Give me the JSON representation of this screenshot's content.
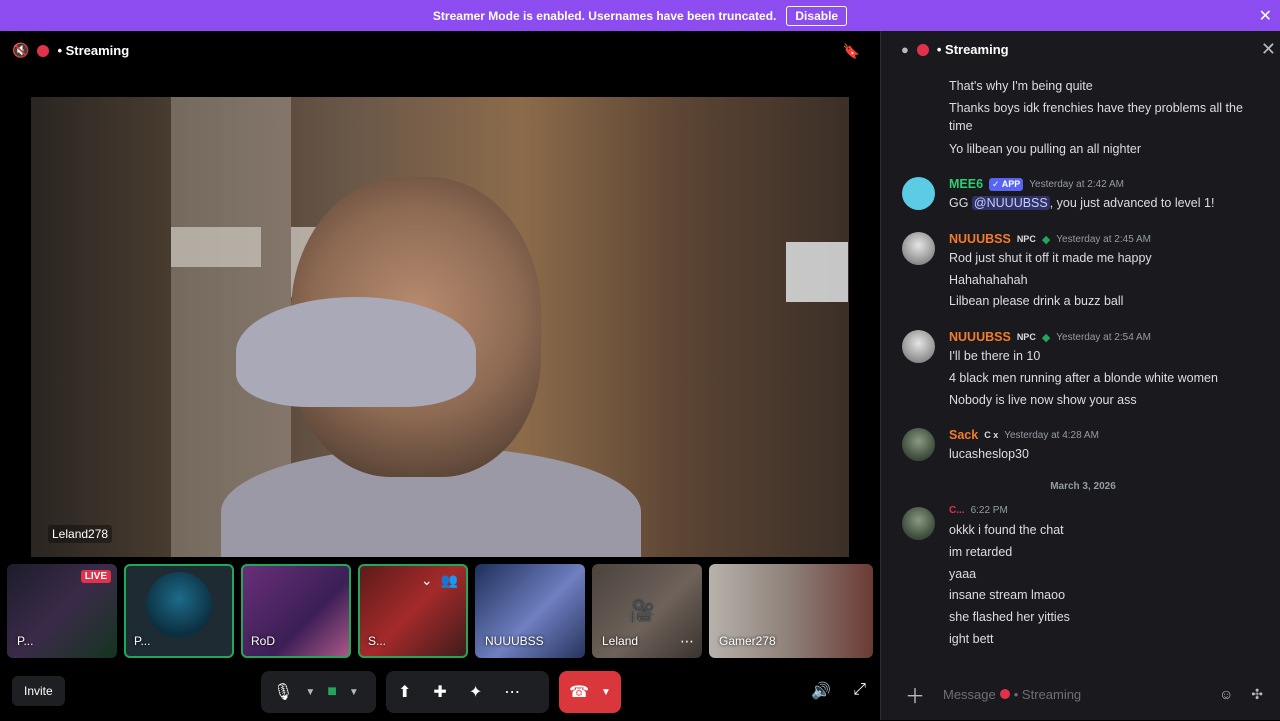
{
  "banner": {
    "text": "Streamer Mode is enabled. Usernames have been truncated.",
    "disable_label": "Disable"
  },
  "stage": {
    "title": "• Streaming",
    "main_video_name": "Leland278"
  },
  "tiles": [
    {
      "label": "P...",
      "live": "LIVE"
    },
    {
      "label": "P..."
    },
    {
      "label": "RoD"
    },
    {
      "label": "S..."
    },
    {
      "label": "NUUUBSS"
    },
    {
      "label": "Leland"
    },
    {
      "label": "Gamer278"
    }
  ],
  "controls": {
    "invite_label": "Invite"
  },
  "chat": {
    "title": "• Streaming",
    "lines_top": [
      "That's why I'm being quite",
      "Thanks boys idk frenchies have they problems all the time",
      "Yo lilbean you pulling an all nighter"
    ],
    "msg_mee6": {
      "user": "MEE6",
      "tag": "✓ APP",
      "time": "Yesterday at 2:42 AM",
      "text_a": "GG ",
      "mention": "@NUUUBSS",
      "text_b": ", you just advanced to level 1!"
    },
    "msg_n1": {
      "user": "NUUUBSS",
      "tag": "NPC",
      "time": "Yesterday at 2:45 AM",
      "lines": [
        "Rod just shut it off it made me happy",
        "Hahahahahah",
        "Lilbean please drink a buzz ball"
      ]
    },
    "msg_n2": {
      "user": "NUUUBSS",
      "tag": "NPC",
      "time": "Yesterday at 2:54 AM",
      "lines": [
        "I'll be there in 10",
        "4 black men running after a blonde white women",
        "Nobody is live now show your ass"
      ]
    },
    "msg_sack": {
      "user": "Sack",
      "tag": "C x",
      "time": "Yesterday at 4:28 AM",
      "lines": [
        "lucasheslop30"
      ]
    },
    "divider": "March 3, 2026",
    "msg_c": {
      "user": "C...",
      "time": "6:22 PM",
      "lines": [
        "okkk i found the chat",
        "im retarded",
        "yaaa",
        "insane stream lmaoo",
        "she flashed her yitties",
        "ight bett"
      ]
    },
    "composer_placeholder": "Message",
    "composer_channel": "• Streaming"
  },
  "colors": {
    "banner": "#8c4cf0",
    "live_red": "#e0334b",
    "speaking_green": "#23a55a",
    "hangup": "#da373c",
    "mee6_name": "#2ecc71",
    "nuuubss_name": "#f47b2a",
    "sack_name": "#f47b2a",
    "c_name": "#e0334b"
  }
}
